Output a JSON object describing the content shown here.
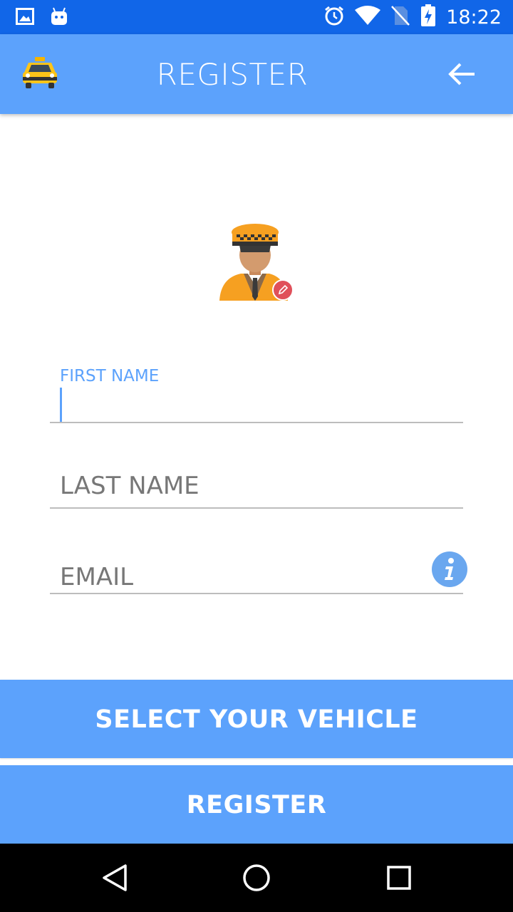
{
  "status_bar": {
    "time": "18:22",
    "icons": [
      "image-icon",
      "android-icon",
      "alarm-icon",
      "wifi-icon",
      "no-sim-icon",
      "battery-charging-icon"
    ]
  },
  "appbar": {
    "title": "REGISTER",
    "logo_icon": "taxi-icon",
    "back_icon": "arrow-left-icon"
  },
  "avatar": {
    "icon": "taxi-driver-avatar",
    "edit_icon": "pencil-icon"
  },
  "form": {
    "first_name": {
      "label": "FIRST NAME",
      "value": ""
    },
    "last_name": {
      "placeholder": "LAST NAME",
      "value": ""
    },
    "email": {
      "placeholder": "EMAIL",
      "value": "",
      "info_icon": "info-icon"
    }
  },
  "buttons": {
    "select_vehicle": "SELECT YOUR VEHICLE",
    "register": "REGISTER"
  },
  "colors": {
    "status_bar": "#1166e8",
    "primary": "#5ca2fc",
    "info": "#6aa7ef",
    "edit_badge": "#e0505a"
  }
}
